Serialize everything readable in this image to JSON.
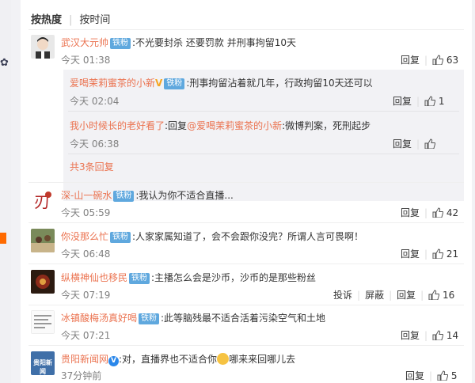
{
  "sort": {
    "hot": "按热度",
    "time": "按时间"
  },
  "badge": "铁粉",
  "reply": "回复",
  "report": "投诉",
  "block": "屏蔽",
  "comments": [
    {
      "name": "武汉大元帅",
      "text": ":不光要封杀 还要罚款 并刑事拘留10天",
      "time": "今天 01:38",
      "likes": "63"
    },
    {
      "name": "深-山一碗水",
      "text": ":我认为你不适合直播...",
      "time": "今天 05:59",
      "likes": "42"
    },
    {
      "name": "你没那么忙",
      "text": ":人家家属知道了，会不会跟你没完？所谓人言可畏啊！",
      "time": "今天 06:48",
      "likes": "21"
    },
    {
      "name": "纵横神仙也移民",
      "text": ":主播怎么会是沙币，沙币的是那些粉丝",
      "time": "今天 07:19",
      "likes": "16"
    },
    {
      "name": "冰镇酸梅汤真好喝",
      "text": ":此等脑残最不适合活着污染空气和土地",
      "time": "今天 07:21",
      "likes": "14"
    },
    {
      "name": "贵阳新闻网",
      "text": ":对，直播界也不适合你",
      "text2": "哪来来回哪儿去",
      "time": "37分钟前",
      "likes": "5",
      "avatar_text": "贵阳新闻"
    }
  ],
  "subreplies": [
    {
      "name": "爱喝茉莉蜜茶的小新",
      "text": ":刑事拘留沾着就几年，行政拘留10天还可以",
      "time": "今天 02:04",
      "likes": "1"
    },
    {
      "name": "我小时候长的老好看了",
      "text_prefix": ":回复",
      "mention": "@爱喝茉莉蜜茶的小新",
      "text": ":微博判案，死刑起步",
      "time": "今天 06:38",
      "likes": ""
    }
  ],
  "more_replies": "共3条回复"
}
